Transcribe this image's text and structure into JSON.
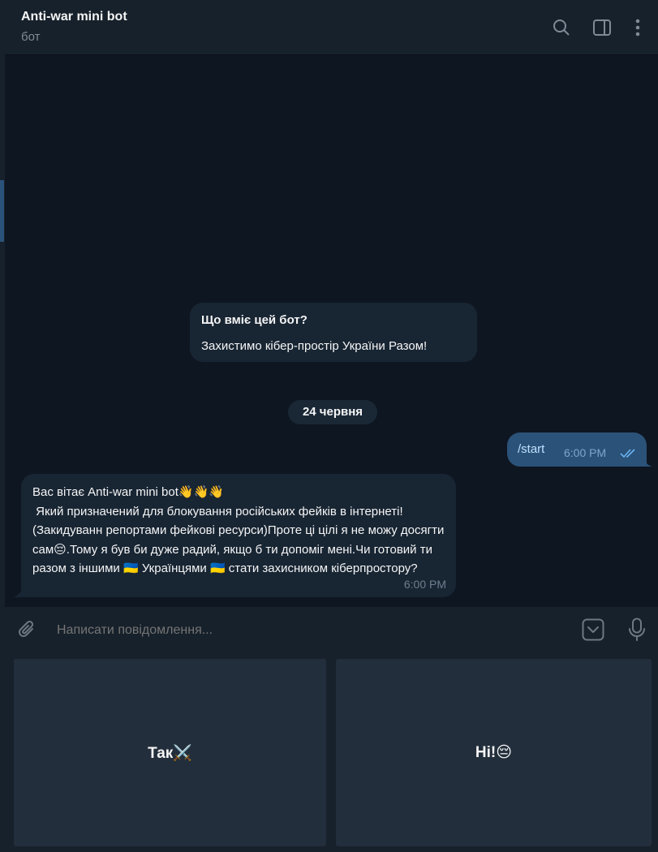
{
  "header": {
    "title": "Anti-war mini bot",
    "subtitle": "бот",
    "icons": [
      "search-icon",
      "sidebar-toggle-icon",
      "more-vertical-icon"
    ]
  },
  "bot_info": {
    "title": "Що вміє цей бот?",
    "description": "Захистимо кібер-простір України Разом!"
  },
  "date_separator": "24 червня",
  "messages": [
    {
      "direction": "outgoing",
      "text": "/start",
      "time": "6:00 PM",
      "status": "read"
    },
    {
      "direction": "incoming",
      "text": "Вас вітає Anti-war mini bot👋👋👋\n Який призначений для блокування російських фейків в інтернеті!(Закидуванн репортами фейкові ресурси)Проте ці цілі я не можу досягти сам😔.Тому я був би дуже радий, якщо б ти допоміг мені.Чи готовий ти разом з іншими 🇺🇦 Українцями 🇺🇦 стати захисником кіберпростору?",
      "time": "6:00 PM"
    }
  ],
  "composer": {
    "placeholder": "Написати повідомлення...",
    "icons": [
      "attach-icon",
      "keyboard-toggle-icon",
      "microphone-icon"
    ]
  },
  "reply_keyboard": [
    {
      "label": "Так⚔️"
    },
    {
      "label": "Ні!😔"
    }
  ],
  "colors": {
    "background": "#0e1621",
    "panel": "#17212b",
    "incoming_bubble": "#182533",
    "outgoing_bubble": "#2b5278",
    "keyboard_button": "#232e3c",
    "read_ticks": "#6ab3f3"
  }
}
